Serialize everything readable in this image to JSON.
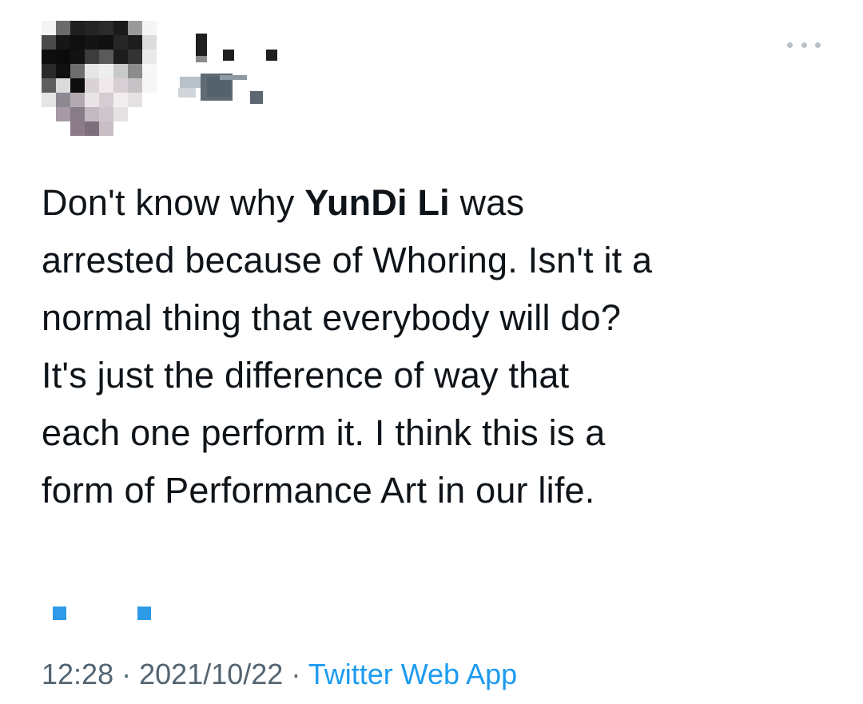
{
  "tweet": {
    "avatar_pixels": [
      [
        "#f4f4f4",
        "#6b6b6b",
        "#1e1e1e",
        "#242424",
        "#2b2b2b",
        "#1a1a1a",
        "#9a9a9a",
        "#f5f5f5"
      ],
      [
        "#4a4a4a",
        "#161616",
        "#0f0f0f",
        "#141414",
        "#101010",
        "#262626",
        "#1d1d1d",
        "#dcdcdc"
      ],
      [
        "#0e0e0e",
        "#0b0b0b",
        "#121212",
        "#3c3c3c",
        "#5a5a5a",
        "#1c1c1c",
        "#333333",
        "#e9e9e9"
      ],
      [
        "#2a2a2a",
        "#101010",
        "#6e6e6e",
        "#e6e6e6",
        "#eeeeee",
        "#c9c9c9",
        "#8c8c8c",
        "#f7f7f7"
      ],
      [
        "#5e5e5e",
        "#dadada",
        "#0d0d0d",
        "#d9d3d6",
        "#f0e8ea",
        "#d8cfd4",
        "#c7c2c5",
        "#f6f6f6"
      ],
      [
        "#e5e5e5",
        "#8e8891",
        "#b2aab0",
        "#e9e5e7",
        "#d6cdd2",
        "#f2eef0",
        "#e6e2e4",
        "#ffffff"
      ],
      [
        "#ffffff",
        "#a59aa5",
        "#877c88",
        "#c3b9c0",
        "#cdc6ca",
        "#e6e1e3",
        "#ffffff",
        "#ffffff"
      ],
      [
        "#ffffff",
        "#ffffff",
        "#8d7b8a",
        "#7d6f7b",
        "#c8bec4",
        "#ffffff",
        "#ffffff",
        "#ffffff"
      ]
    ],
    "more_label": "More",
    "text": {
      "l1_pre": "Don't know why ",
      "l1_bold": "YunDi Li",
      "l1_post": " was",
      "l2": "arrested because of Whoring. Isn't it a",
      "l3": "normal thing that everybody will do?",
      "l4": "It's just the difference of way that",
      "l5": "each one perform it. I think this is a",
      "l6": "form of Performance Art in our life."
    },
    "time": "12:28",
    "separator": "·",
    "date": "2021/10/22",
    "source": "Twitter Web App",
    "colors": {
      "text": "#0f1419",
      "meta": "#536471",
      "link": "#1d9bf0",
      "translate_mark": "#2f9be8"
    }
  }
}
